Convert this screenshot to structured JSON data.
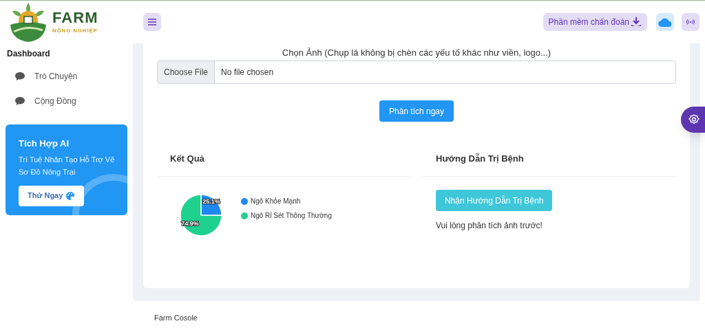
{
  "logo": {
    "title": "FARM",
    "subtitle": "NÔNG NGHIỆP"
  },
  "header": {
    "download_button": "Phần mềm chấn đoán"
  },
  "sidebar": {
    "heading": "Dashboard",
    "items": [
      {
        "label": "Trò Chuyện"
      },
      {
        "label": "Cộng Đồng"
      }
    ],
    "promo": {
      "title": "Tích Hợp AI",
      "text": "Trí Tuệ Nhân Tạo Hỗ Trợ Vẽ Sơ Đồ Nông Trại",
      "button": "Thử Ngay"
    }
  },
  "upload": {
    "label": "Chọn Ảnh (Chụp lá không bị chèn các yếu tố khác như viền, logo...)",
    "button": "Choose File",
    "value": "No file chosen"
  },
  "analyze_button": "Phân tích ngay",
  "result": {
    "title": "Kết Quả",
    "chart_data": {
      "type": "pie",
      "categories": [
        "Ngô Khỏe Mạnh",
        "Ngô Rỉ Sét Thông Thường"
      ],
      "series": [
        {
          "colors": [
            "#1e88f0",
            "#1fd18f"
          ],
          "values": [
            25.1,
            74.9
          ]
        }
      ],
      "value_labels": [
        "25.1%",
        "74.9%"
      ]
    }
  },
  "guide": {
    "title": "Hướng Dẫn Trị Bệnh",
    "button": "Nhận Hướng Dẫn Trị Bệnh",
    "note": "Vui lòng phân tích ảnh trước!"
  },
  "footer": "Farm Cosole"
}
